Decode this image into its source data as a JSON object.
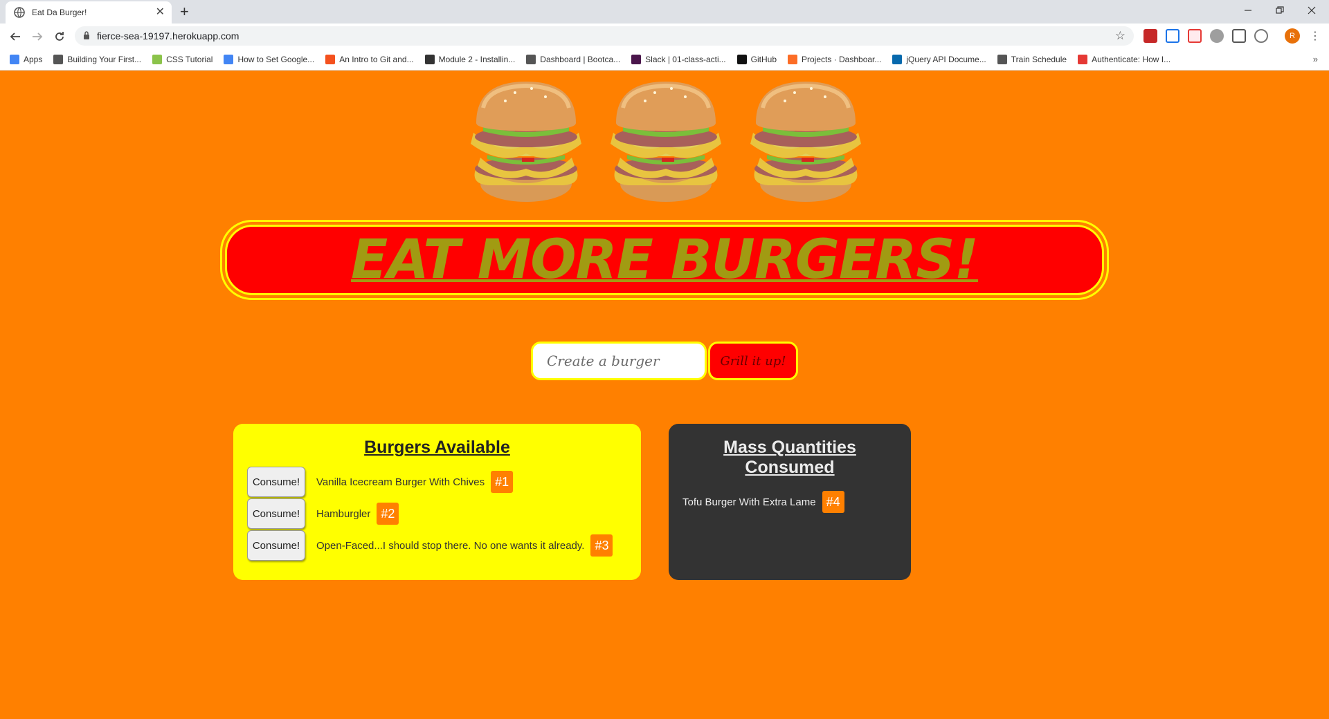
{
  "browser": {
    "tab_title": "Eat Da Burger!",
    "tab_close": "✕",
    "new_tab": "+",
    "url": "fierce-sea-19197.herokuapp.com",
    "profile_initial": "R",
    "bookmarks": [
      {
        "label": "Apps",
        "color": "#4285f4"
      },
      {
        "label": "Building Your First...",
        "color": "#555555"
      },
      {
        "label": "CSS Tutorial",
        "color": "#8bc34a"
      },
      {
        "label": "How to Set Google...",
        "color": "#4285f4"
      },
      {
        "label": "An Intro to Git and...",
        "color": "#f4511e"
      },
      {
        "label": "Module 2 - Installin...",
        "color": "#333333"
      },
      {
        "label": "Dashboard | Bootca...",
        "color": "#555555"
      },
      {
        "label": "Slack | 01-class-acti...",
        "color": "#4a154b"
      },
      {
        "label": "GitHub",
        "color": "#111111"
      },
      {
        "label": "Projects · Dashboar...",
        "color": "#fc6d26"
      },
      {
        "label": "jQuery API Docume...",
        "color": "#0769ad"
      },
      {
        "label": "Train Schedule",
        "color": "#555555"
      },
      {
        "label": "Authenticate: How I...",
        "color": "#e53935"
      }
    ]
  },
  "page": {
    "banner_title": "EAT MORE BURGERS!",
    "form": {
      "placeholder": "Create a burger",
      "submit_label": "Grill it up!"
    },
    "available": {
      "title": "Burgers Available",
      "button_label": "Consume!",
      "items": [
        {
          "name": "Vanilla Icecream Burger With Chives",
          "id": "#1"
        },
        {
          "name": "Hamburgler",
          "id": "#2"
        },
        {
          "name": "Open-Faced...I should stop there. No one wants it already.",
          "id": "#3"
        }
      ]
    },
    "consumed": {
      "title": "Mass Quantities Consumed",
      "items": [
        {
          "name": "Tofu Burger With Extra Lame",
          "id": "#4"
        }
      ]
    }
  },
  "colors": {
    "background": "#ff8000",
    "banner": "#ff0000",
    "accent_yellow": "#ffff00",
    "title_olive": "#a19b12",
    "dark_panel": "#333333"
  }
}
